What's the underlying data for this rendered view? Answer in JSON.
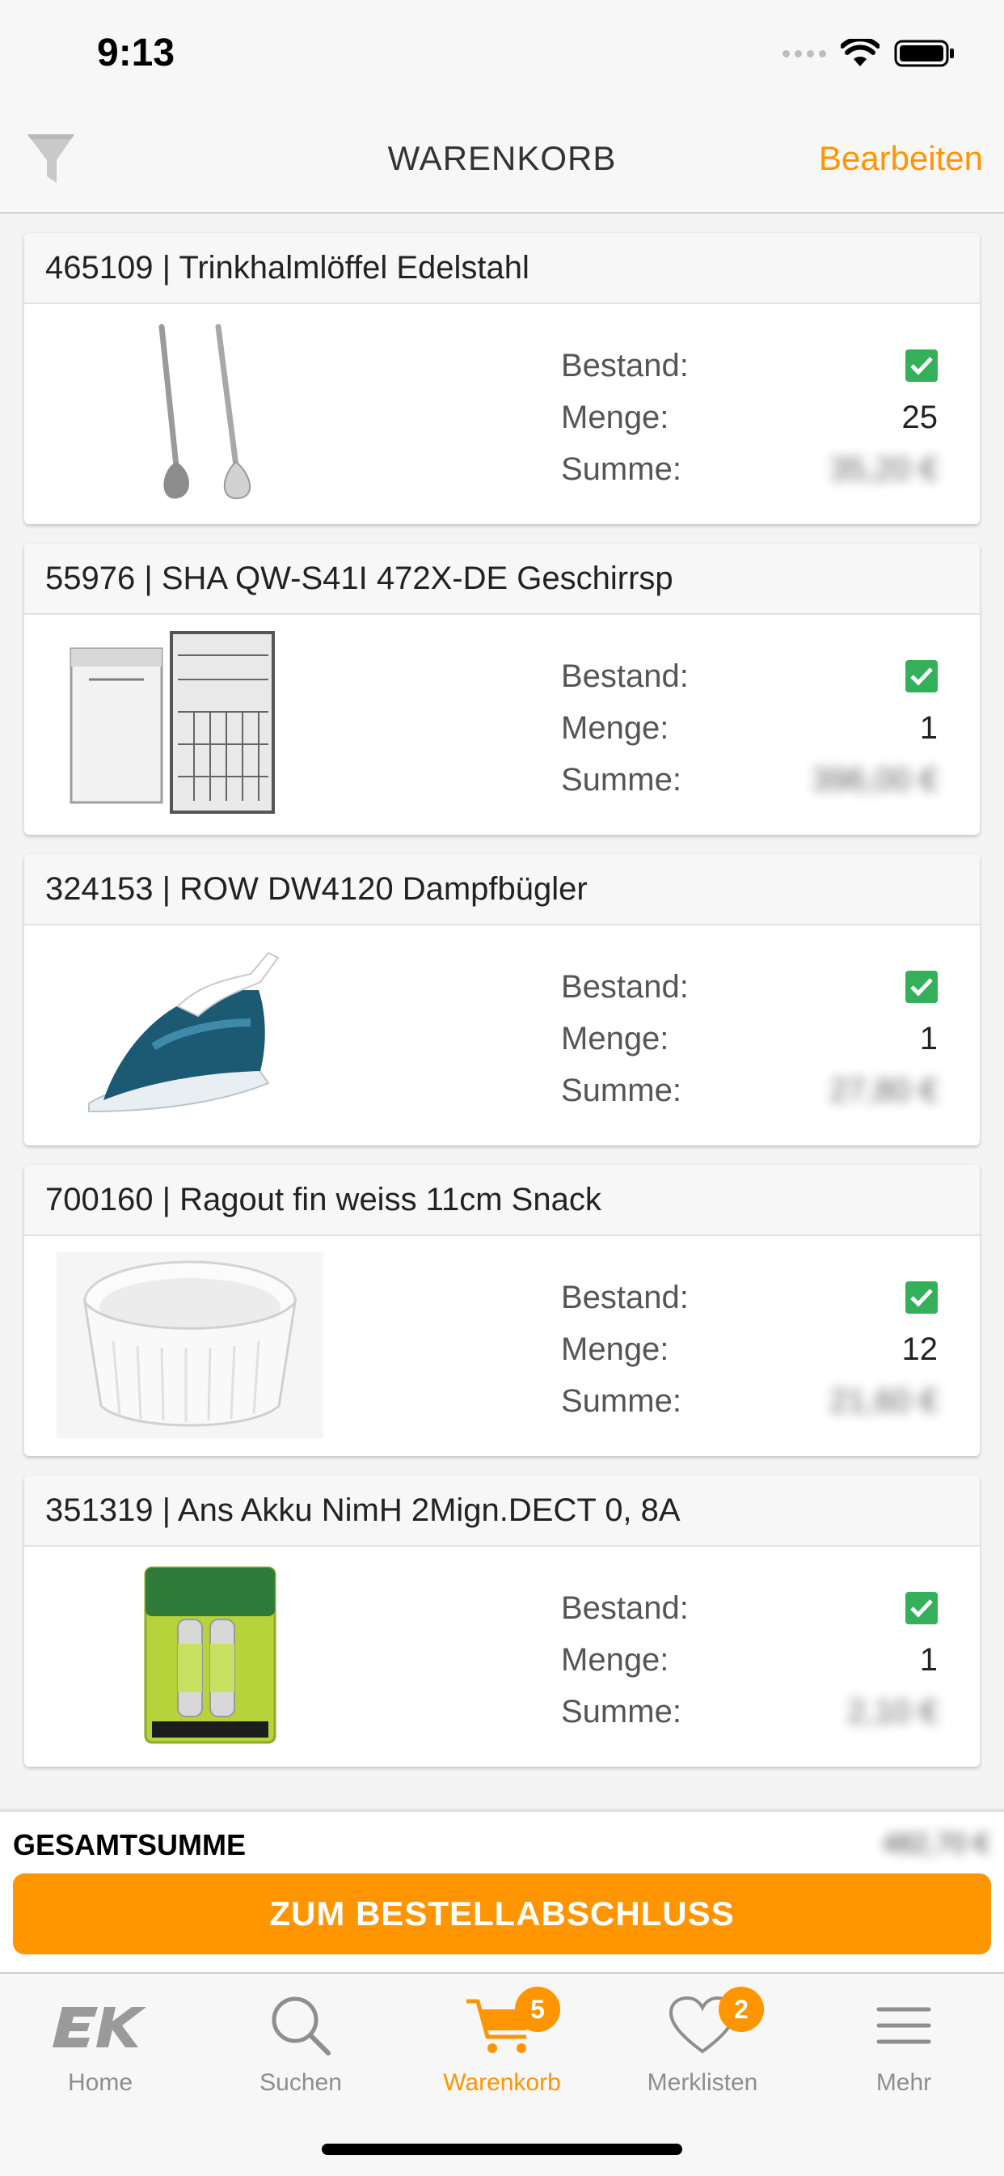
{
  "status_bar": {
    "time": "9:13"
  },
  "nav": {
    "title": "WARENKORB",
    "edit_label": "Bearbeiten"
  },
  "labels": {
    "stock": "Bestand:",
    "quantity": "Menge:",
    "sum": "Summe:"
  },
  "items": [
    {
      "title": "465109 | Trinkhalmlöffel Edelstahl",
      "in_stock": true,
      "quantity": "25",
      "sum": "35,20 €",
      "image": "spoons"
    },
    {
      "title": "55976 | SHA QW-S41I 472X-DE Geschirrsp",
      "in_stock": true,
      "quantity": "1",
      "sum": "396,00 €",
      "image": "dishwasher"
    },
    {
      "title": "324153 | ROW DW4120 Dampfbügler",
      "in_stock": true,
      "quantity": "1",
      "sum": "27,80 €",
      "image": "iron"
    },
    {
      "title": "700160 | Ragout fin weiss 11cm Snack",
      "in_stock": true,
      "quantity": "12",
      "sum": "21,60 €",
      "image": "ramekin"
    },
    {
      "title": "351319 | Ans Akku NimH 2Mign.DECT 0, 8A",
      "in_stock": true,
      "quantity": "1",
      "sum": "2,10 €",
      "image": "battery"
    }
  ],
  "total": {
    "label": "GESAMTSUMME",
    "value": "482,70 €"
  },
  "checkout_label": "ZUM BESTELLABSCHLUSS",
  "tabs": [
    {
      "label": "Home",
      "icon": "ek-logo-icon",
      "active": false
    },
    {
      "label": "Suchen",
      "icon": "search-icon",
      "active": false
    },
    {
      "label": "Warenkorb",
      "icon": "cart-icon",
      "active": true,
      "badge": "5"
    },
    {
      "label": "Merklisten",
      "icon": "heart-icon",
      "active": false,
      "badge": "2"
    },
    {
      "label": "Mehr",
      "icon": "menu-icon",
      "active": false
    }
  ],
  "colors": {
    "accent": "#ff9500",
    "check": "#34b05a"
  }
}
